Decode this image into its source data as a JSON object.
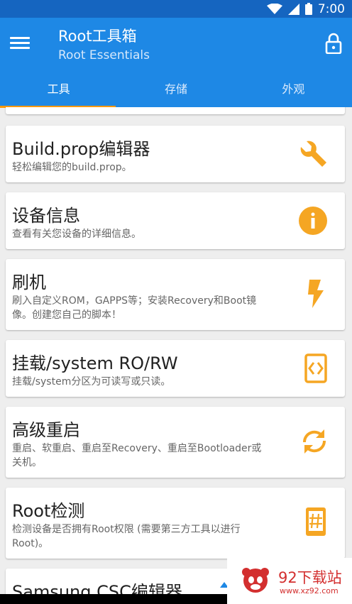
{
  "status_bar": {
    "time": "7:00"
  },
  "app_bar": {
    "title": "Root工具箱",
    "subtitle": "Root Essentials",
    "menu_icon": "menu-icon",
    "lock_icon": "lock-icon"
  },
  "tabs": [
    {
      "label": "工具",
      "active": true
    },
    {
      "label": "存储",
      "active": false
    },
    {
      "label": "外观",
      "active": false
    }
  ],
  "accent_color": "#ff9800",
  "primary_color": "#1e88e5",
  "cards": [
    {
      "title": "Build.prop编辑器",
      "desc": "轻松编辑您的build.prop。",
      "icon": "wrench-icon"
    },
    {
      "title": "设备信息",
      "desc": "查看有关您设备的详细信息。",
      "icon": "info-icon"
    },
    {
      "title": "刷机",
      "desc": "刷入自定义ROM，GAPPS等；安装Recovery和Boot镜像。创建您自己的脚本！",
      "icon": "flash-icon"
    },
    {
      "title": "挂载/system RO/RW",
      "desc": "挂载/system分区为可读写或只读。",
      "icon": "mount-icon"
    },
    {
      "title": "高级重启",
      "desc": "重启、软重启、重启至Recovery、重启至Bootloader或关机。",
      "icon": "reboot-icon"
    },
    {
      "title": "Root检测",
      "desc": "检测设备是否拥有Root权限 (需要第三方工具以进行Root)。",
      "icon": "root-check-icon"
    },
    {
      "title": "Samsung CSC编辑器",
      "desc": "",
      "icon": ""
    }
  ],
  "watermark": {
    "title": "92下载站",
    "url": "www.xz92.com"
  }
}
